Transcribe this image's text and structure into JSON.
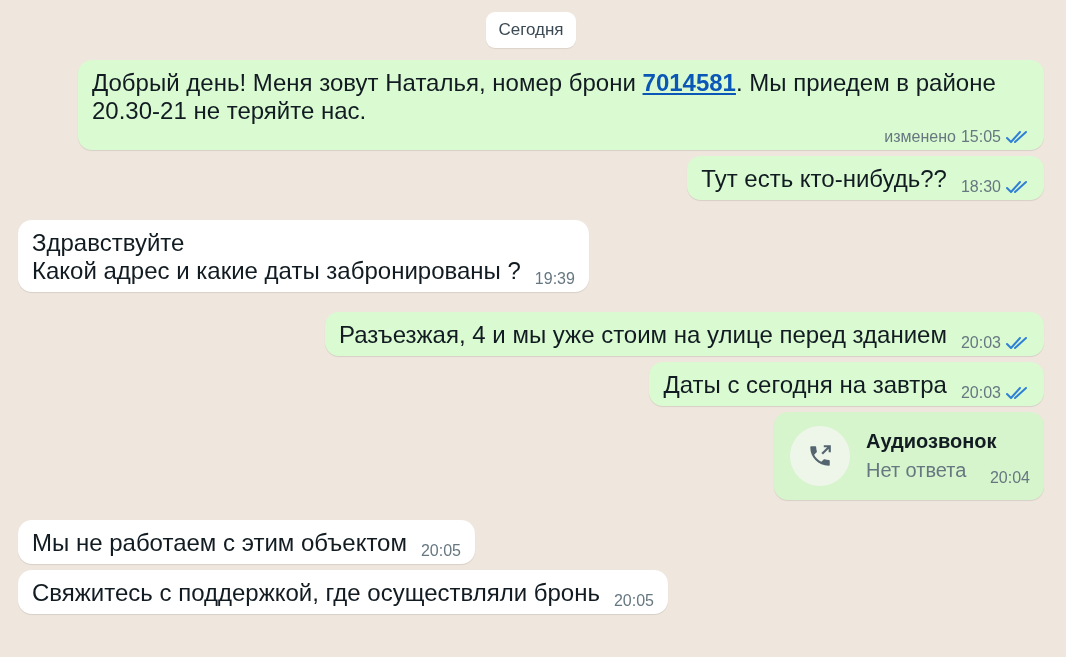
{
  "date_chip": "Сегодня",
  "messages": [
    {
      "kind": "text",
      "outgoing": true,
      "segments": [
        {
          "text": "Добрый день! Меня зовут Наталья, номер брони ",
          "link": false
        },
        {
          "text": "7014581",
          "link": true
        },
        {
          "text": ". Мы приедем в районе 20.30-21 не теряйте нас.",
          "link": false
        }
      ],
      "edited": "изменено",
      "time": "15:05",
      "read": true
    },
    {
      "kind": "text",
      "outgoing": true,
      "segments": [
        {
          "text": "Тут есть кто-нибудь??",
          "link": false
        }
      ],
      "time": "18:30",
      "read": true
    },
    {
      "kind": "text",
      "outgoing": false,
      "segments": [
        {
          "text": "Здравствуйте\nКакой адрес и какие даты забронированы ?",
          "link": false
        }
      ],
      "time": "19:39"
    },
    {
      "kind": "text",
      "outgoing": true,
      "segments": [
        {
          "text": "Разъезжая, 4 и мы уже стоим на улице перед зданием",
          "link": false
        }
      ],
      "time": "20:03",
      "read": true
    },
    {
      "kind": "text",
      "outgoing": true,
      "segments": [
        {
          "text": "Даты с сегодня на завтра",
          "link": false
        }
      ],
      "time": "20:03",
      "read": true
    },
    {
      "kind": "call",
      "outgoing": true,
      "title": "Аудиозвонок",
      "subtitle": "Нет ответа",
      "time": "20:04"
    },
    {
      "kind": "text",
      "outgoing": false,
      "segments": [
        {
          "text": "Мы не работаем с этим объектом",
          "link": false
        }
      ],
      "time": "20:05"
    },
    {
      "kind": "text",
      "outgoing": false,
      "segments": [
        {
          "text": "Свяжитесь с поддержкой, где осуществляли бронь",
          "link": false
        }
      ],
      "time": "20:05"
    }
  ]
}
